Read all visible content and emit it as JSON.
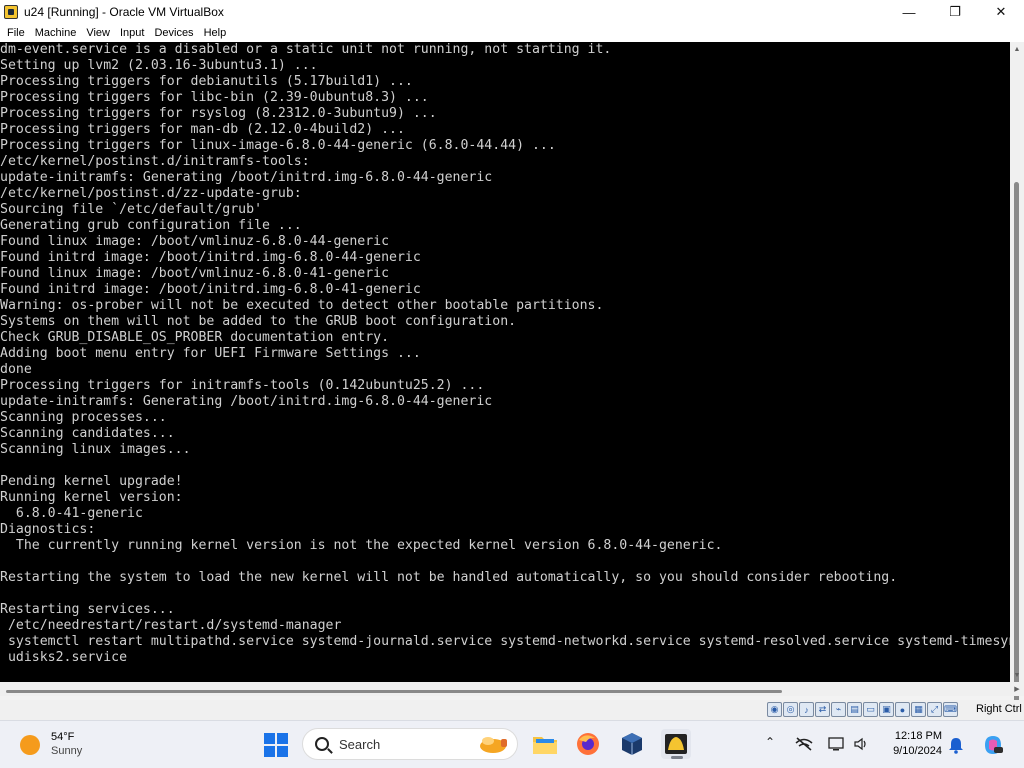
{
  "window": {
    "title": "u24 [Running] - Oracle VM VirtualBox",
    "minimize_glyph": "—",
    "maximize_glyph": "❐",
    "close_glyph": "✕"
  },
  "menu": {
    "items": [
      "File",
      "Machine",
      "View",
      "Input",
      "Devices",
      "Help"
    ]
  },
  "terminal": {
    "lines": [
      "dm-event.service is a disabled or a static unit not running, not starting it.",
      "Setting up lvm2 (2.03.16-3ubuntu3.1) ...",
      "Processing triggers for debianutils (5.17build1) ...",
      "Processing triggers for libc-bin (2.39-0ubuntu8.3) ...",
      "Processing triggers for rsyslog (8.2312.0-3ubuntu9) ...",
      "Processing triggers for man-db (2.12.0-4build2) ...",
      "Processing triggers for linux-image-6.8.0-44-generic (6.8.0-44.44) ...",
      "/etc/kernel/postinst.d/initramfs-tools:",
      "update-initramfs: Generating /boot/initrd.img-6.8.0-44-generic",
      "/etc/kernel/postinst.d/zz-update-grub:",
      "Sourcing file `/etc/default/grub'",
      "Generating grub configuration file ...",
      "Found linux image: /boot/vmlinuz-6.8.0-44-generic",
      "Found initrd image: /boot/initrd.img-6.8.0-44-generic",
      "Found linux image: /boot/vmlinuz-6.8.0-41-generic",
      "Found initrd image: /boot/initrd.img-6.8.0-41-generic",
      "Warning: os-prober will not be executed to detect other bootable partitions.",
      "Systems on them will not be added to the GRUB boot configuration.",
      "Check GRUB_DISABLE_OS_PROBER documentation entry.",
      "Adding boot menu entry for UEFI Firmware Settings ...",
      "done",
      "Processing triggers for initramfs-tools (0.142ubuntu25.2) ...",
      "update-initramfs: Generating /boot/initrd.img-6.8.0-44-generic",
      "Scanning processes...",
      "Scanning candidates...",
      "Scanning linux images...",
      "",
      "Pending kernel upgrade!",
      "Running kernel version:",
      "  6.8.0-41-generic",
      "Diagnostics:",
      "  The currently running kernel version is not the expected kernel version 6.8.0-44-generic.",
      "",
      "Restarting the system to load the new kernel will not be handled automatically, so you should consider rebooting.",
      "",
      "Restarting services...",
      " /etc/needrestart/restart.d/systemd-manager",
      " systemctl restart multipathd.service systemd-journald.service systemd-networkd.service systemd-resolved.service systemd-timesyncd.service",
      " udisks2.service"
    ]
  },
  "scrollbar": {
    "up_glyph": "▲",
    "down_glyph": "▼",
    "left_glyph": "◀",
    "right_glyph": "▶"
  },
  "statusbar": {
    "icons": [
      "hard-disk-icon",
      "optical-drive-icon",
      "audio-icon",
      "network-icon",
      "usb-icon",
      "shared-folders-icon",
      "display-icon",
      "video-capture-icon",
      "recording-icon",
      "virtualization-icon",
      "mouse-integration-icon",
      "keyboard-icon"
    ],
    "host_key": "Right Ctrl"
  },
  "taskbar": {
    "weather_temp": "54°F",
    "weather_condition": "Sunny",
    "search_placeholder": "Search",
    "tray_chevron": "⌃",
    "time": "12:18 PM",
    "date": "9/10/2024",
    "colors": {
      "start": "#1a73e8",
      "sun": "#f59b1c",
      "folder": "#f6c343",
      "firefox": "#ff7139",
      "virtualbox": "#1b3a6b"
    }
  }
}
